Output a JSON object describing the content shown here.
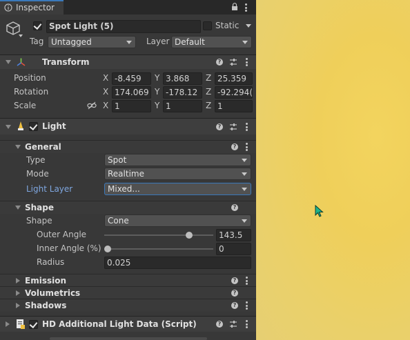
{
  "tab": {
    "label": "Inspector"
  },
  "object": {
    "name": "Spot Light (5)",
    "active": true,
    "static_label": "Static",
    "tag_label": "Tag",
    "tag_value": "Untagged",
    "layer_label": "Layer",
    "layer_value": "Default"
  },
  "transform": {
    "title": "Transform",
    "position": {
      "label": "Position",
      "x": "-8.459",
      "y": "3.868",
      "z": "25.359"
    },
    "rotation": {
      "label": "Rotation",
      "x": "174.069",
      "y": "-178.12",
      "z": "-92.294("
    },
    "scale": {
      "label": "Scale",
      "x": "1",
      "y": "1",
      "z": "1"
    },
    "axis_x": "X",
    "axis_y": "Y",
    "axis_z": "Z"
  },
  "light": {
    "title": "Light",
    "enabled": true,
    "general": {
      "title": "General",
      "type_label": "Type",
      "type_value": "Spot",
      "mode_label": "Mode",
      "mode_value": "Realtime",
      "light_layer_label": "Light Layer",
      "light_layer_value": "Mixed..."
    },
    "shape": {
      "title": "Shape",
      "shape_label": "Shape",
      "shape_value": "Cone",
      "outer_angle_label": "Outer Angle",
      "outer_angle_value": "143.5",
      "outer_angle_fraction": 0.8,
      "inner_angle_label": "Inner Angle (%)",
      "inner_angle_value": "0",
      "inner_angle_fraction": 0.0,
      "radius_label": "Radius",
      "radius_value": "0.025"
    },
    "emission_title": "Emission",
    "volumetrics_title": "Volumetrics",
    "shadows_title": "Shadows"
  },
  "hd_data": {
    "title": "HD Additional Light Data (Script)",
    "enabled": true
  },
  "colors": {
    "accent_blue": "#3a79bb",
    "light_layer_text": "#7fa7e0",
    "scene_yellow": "#efcf5a"
  }
}
